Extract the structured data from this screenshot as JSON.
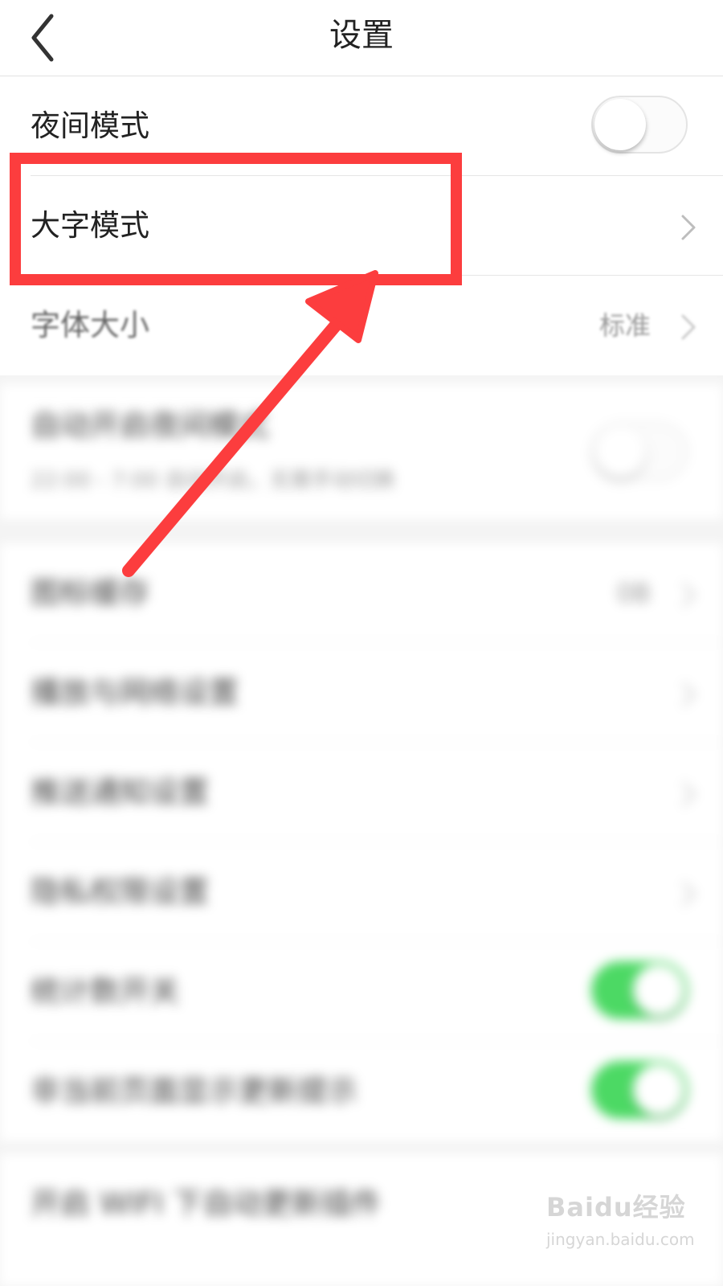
{
  "header": {
    "title": "设置",
    "back_icon": "chevron-left-icon"
  },
  "group1": [
    {
      "label": "夜间模式",
      "control": "toggle",
      "on": false
    },
    {
      "label": "大字模式",
      "control": "chevron"
    },
    {
      "label": "字体大小",
      "value": "标准",
      "control": "chevron"
    }
  ],
  "group2": [
    {
      "label": "自动开启夜间模式",
      "subtitle": "22:00 - 7:00 自动开启，无需手动切换",
      "control": "toggle",
      "on": false
    }
  ],
  "group3": [
    {
      "label": "图标缓存",
      "value": "0B",
      "control": "chevron"
    },
    {
      "label": "播放与网络设置",
      "control": "chevron"
    },
    {
      "label": "推送通知设置",
      "control": "chevron"
    },
    {
      "label": "隐私权限设置",
      "control": "chevron"
    },
    {
      "label": "统计数开关",
      "control": "toggle",
      "on": true
    },
    {
      "label": "非当前页面显示更新提示",
      "control": "toggle",
      "on": true
    }
  ],
  "group4": [
    {
      "label": "开启 WIFI 下自动更新插件"
    }
  ],
  "colors": {
    "accent": "#fc3d3e",
    "toggle_on": "#4cd964",
    "header_bg": "#ffffff",
    "page_bg": "#f4f4f4"
  },
  "watermark": {
    "logo": "Baidu经验",
    "url": "jingyan.baidu.com"
  }
}
